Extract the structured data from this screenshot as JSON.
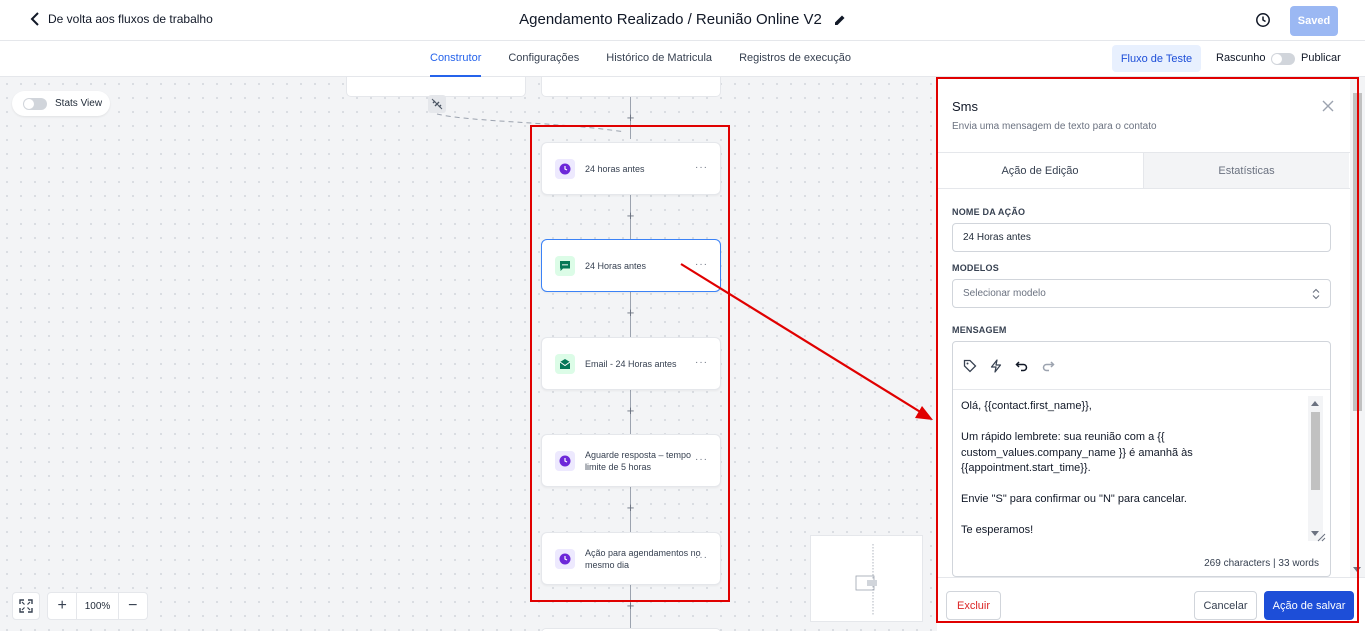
{
  "header": {
    "back_label": "De volta aos fluxos de trabalho",
    "title": "Agendamento Realizado / Reunião Online V2",
    "saved_label": "Saved"
  },
  "tabs": [
    {
      "label": "Construtor",
      "active": true
    },
    {
      "label": "Configurações",
      "active": false
    },
    {
      "label": "Histórico de Matricula",
      "active": false
    },
    {
      "label": "Registros de execução",
      "active": false
    }
  ],
  "toolbar_right": {
    "test_flow_label": "Fluxo de Teste",
    "draft_label": "Rascunho",
    "publish_label": "Publicar"
  },
  "canvas": {
    "stats_view_label": "Stats View",
    "zoom_level": "100%",
    "nodes": [
      {
        "label": "24 horas antes",
        "icon": "clock-icon",
        "color": "purple"
      },
      {
        "label": "24 Horas antes",
        "icon": "sms-icon",
        "color": "green"
      },
      {
        "label": "Email - 24 Horas antes",
        "icon": "email-icon",
        "color": "green"
      },
      {
        "label": "Aguarde resposta – tempo limite de 5 horas",
        "icon": "clock-icon",
        "color": "purple"
      },
      {
        "label": "Ação para agendamentos no mesmo dia",
        "icon": "clock-icon",
        "color": "purple"
      }
    ]
  },
  "panel": {
    "title": "Sms",
    "subtitle": "Envia uma mensagem de texto para o contato",
    "tabs": [
      "Ação de Edição",
      "Estatísticas"
    ],
    "action_name_label": "NOME DA AÇÃO",
    "action_name_value": "24 Horas antes",
    "templates_label": "MODELOS",
    "templates_placeholder": "Selecionar modelo",
    "message_label": "MENSAGEM",
    "message_body": "Olá, {{contact.first_name}},\n\nUm rápido lembrete: sua reunião com a {{ custom_values.company_name }} é amanhã às {{appointment.start_time}}.\n\nEnvie \"S\" para confirmar ou \"N\" para cancelar.\n\nTe esperamos!",
    "char_count": "269 characters | 33 words",
    "delete_label": "Excluir",
    "cancel_label": "Cancelar",
    "save_label": "Ação de salvar"
  },
  "colors": {
    "accent": "#2563eb",
    "highlight": "#e00000",
    "save_button": "#1d4ed8"
  }
}
